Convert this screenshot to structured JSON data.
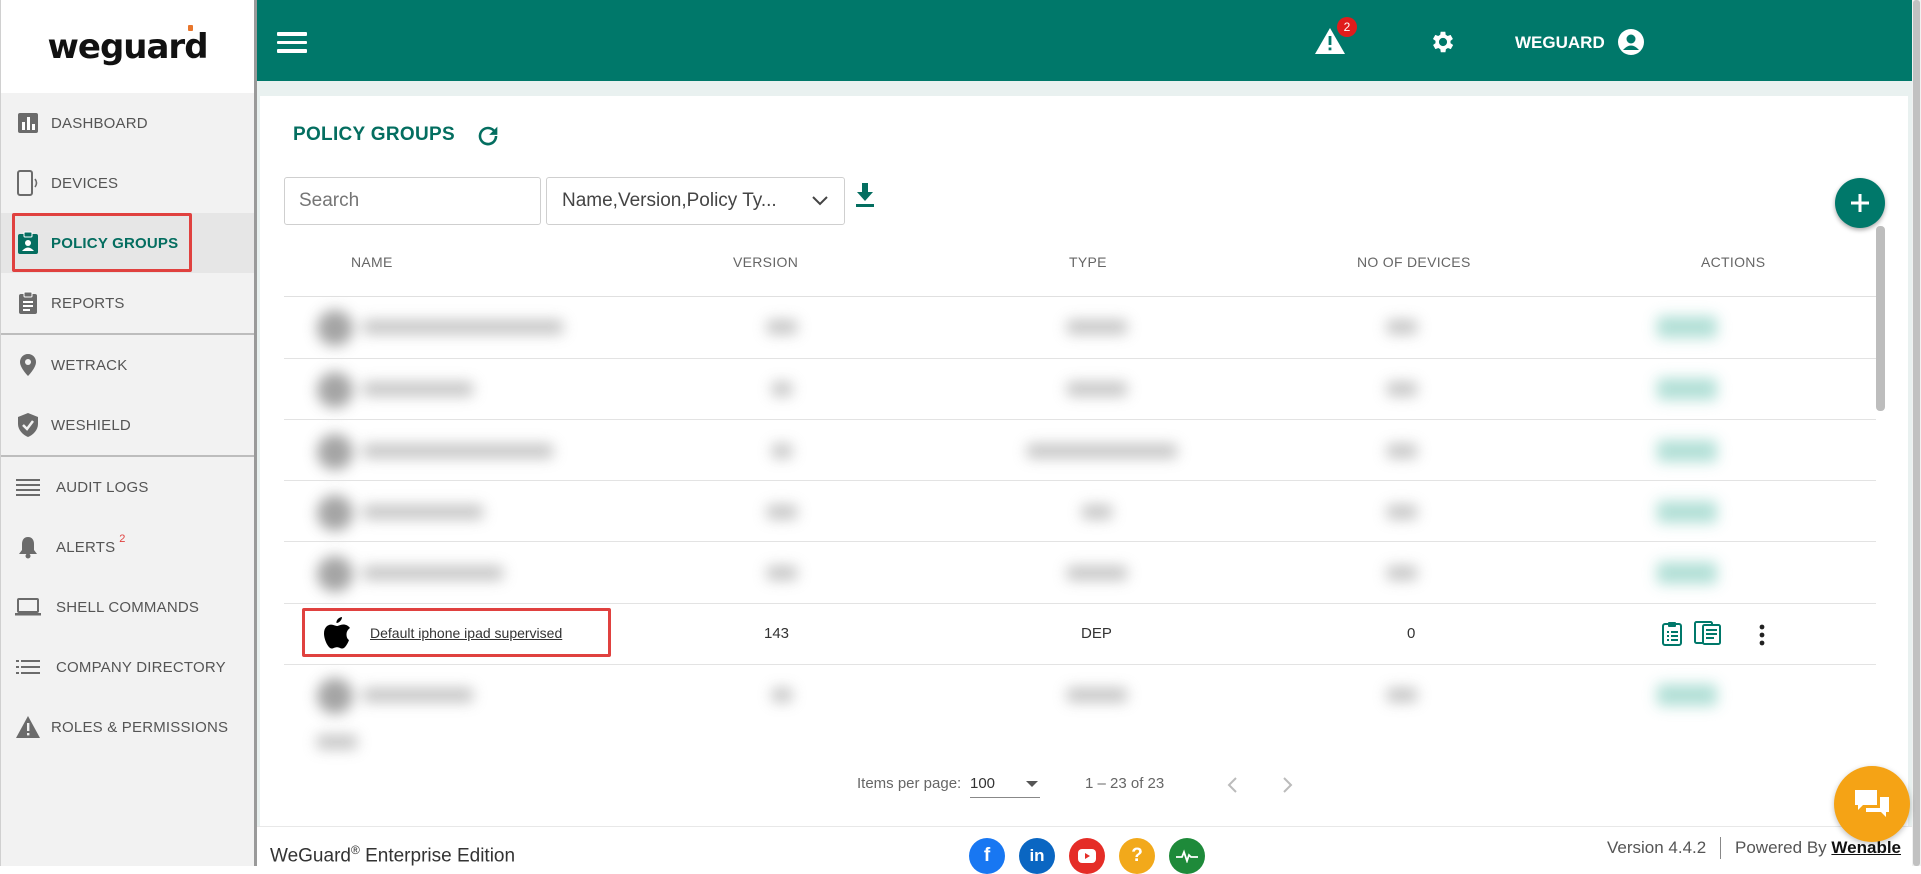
{
  "brand": {
    "logo_text": "weguard"
  },
  "sidebar": {
    "items": [
      {
        "label": "DASHBOARD",
        "icon": "bar-chart-icon"
      },
      {
        "label": "DEVICES",
        "icon": "phone-icon"
      },
      {
        "label": "POLICY GROUPS",
        "icon": "policy-badge-icon",
        "active": true
      },
      {
        "label": "REPORTS",
        "icon": "clipboard-icon"
      },
      {
        "label": "WETRACK",
        "icon": "location-pin-icon"
      },
      {
        "label": "WESHIELD",
        "icon": "shield-check-icon"
      },
      {
        "label": "AUDIT LOGS",
        "icon": "lines-icon"
      },
      {
        "label": "ALERTS",
        "icon": "bell-icon",
        "badge": "2"
      },
      {
        "label": "SHELL COMMANDS",
        "icon": "laptop-icon"
      },
      {
        "label": "COMPANY DIRECTORY",
        "icon": "list-icon"
      },
      {
        "label": "ROLES & PERMISSIONS",
        "icon": "warning-icon"
      }
    ]
  },
  "topbar": {
    "alert_count": "2",
    "user_name": "WEGUARD"
  },
  "page": {
    "title": "POLICY GROUPS",
    "search_placeholder": "Search",
    "column_filter_value": "Name,Version,Policy Ty..."
  },
  "table": {
    "columns": [
      "NAME",
      "VERSION",
      "TYPE",
      "NO OF DEVICES",
      "ACTIONS"
    ],
    "visible_row": {
      "name": "Default iphone ipad supervised",
      "version": "143",
      "type": "DEP",
      "devices": "0"
    }
  },
  "paginator": {
    "items_per_page_label": "Items per page:",
    "items_per_page_value": "100",
    "range_label": "1 – 23 of 23"
  },
  "footer": {
    "edition_prefix": "WeGuard",
    "edition_reg": "®",
    "edition_suffix": " Enterprise Edition",
    "version": "Version 4.4.2",
    "powered_by": "Powered By",
    "company": "Wenable"
  },
  "colors": {
    "primary": "#00786a",
    "highlight": "#e0413f",
    "chat": "#f5a315"
  }
}
